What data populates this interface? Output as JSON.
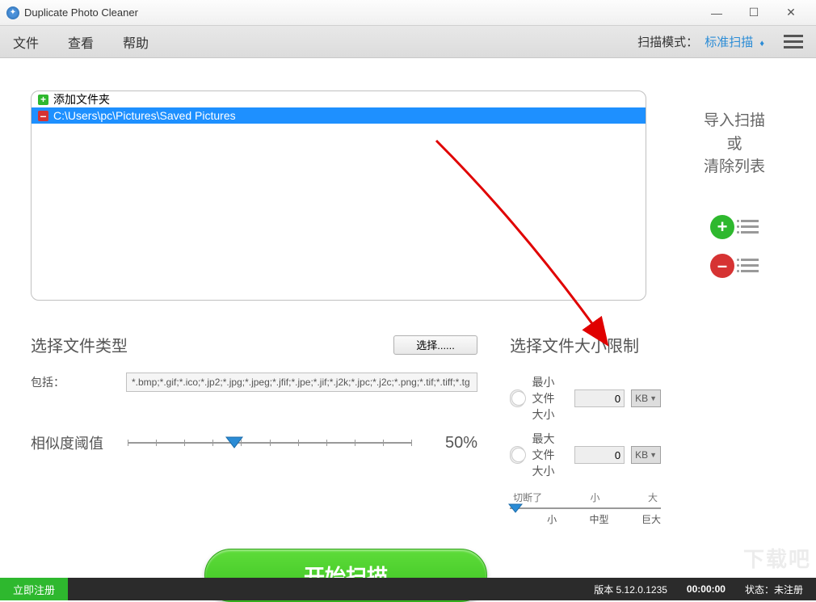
{
  "window": {
    "title": "Duplicate Photo Cleaner"
  },
  "menu": {
    "file": "文件",
    "view": "查看",
    "help": "帮助",
    "scan_mode_label": "扫描模式：",
    "scan_mode_value": "标准扫描"
  },
  "folders": {
    "add_label": "添加文件夹",
    "items": [
      {
        "path": "C:\\Users\\pc\\Pictures\\Saved Pictures"
      }
    ]
  },
  "right_panel": {
    "line1": "导入扫描",
    "line2": "或",
    "line3": "清除列表"
  },
  "filetype": {
    "title": "选择文件类型",
    "select_btn": "选择......",
    "include_label": "包括：",
    "include_value": "*.bmp;*.gif;*.ico;*.jp2;*.jpg;*.jpeg;*.jfif;*.jpe;*.jif;*.j2k;*.jpc;*.j2c;*.png;*.tif;*.tiff;*.tg"
  },
  "similarity": {
    "label": "相似度阈值",
    "value": "50%"
  },
  "filesize": {
    "title": "选择文件大小限制",
    "min_label": "最小文件大小",
    "max_label": "最大文件大小",
    "min_value": "0",
    "max_value": "0",
    "unit": "KB",
    "cut": "切断了",
    "small_top": "小",
    "big_top": "大",
    "small_bot": "小",
    "mid_bot": "中型",
    "huge_bot": "巨大"
  },
  "start_btn": "开始扫描",
  "status": {
    "register": "立即注册",
    "version": "版本 5.12.0.1235",
    "time": "00:00:00",
    "state_label": "状态：",
    "state_value": "未注册"
  },
  "watermark": "下载吧"
}
